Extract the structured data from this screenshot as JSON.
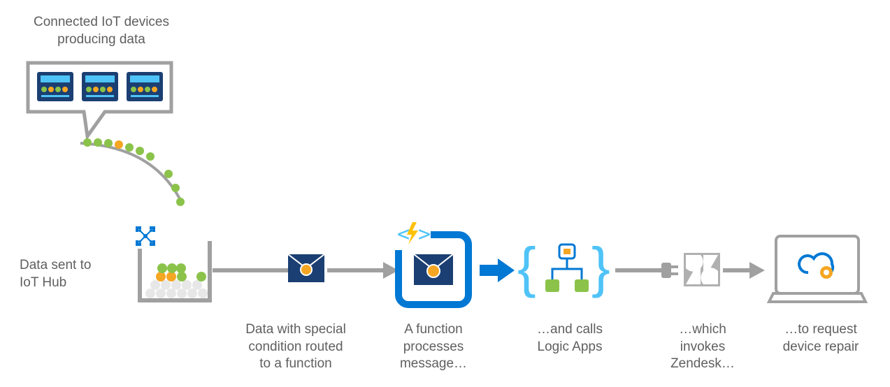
{
  "labels": {
    "devices_title_1": "Connected IoT devices",
    "devices_title_2": "producing data",
    "hub_1": "Data sent to",
    "hub_2": "IoT Hub",
    "routed_1": "Data with special",
    "routed_2": "condition routed",
    "routed_3": "to a function",
    "function_1": "A function",
    "function_2": "processes",
    "function_3": "message…",
    "logic_1": "…and calls",
    "logic_2": "Logic Apps",
    "zendesk_1": "…which",
    "zendesk_2": "invokes",
    "zendesk_3": "Zendesk…",
    "repair_1": "…to request",
    "repair_2": "device repair"
  },
  "colors": {
    "blue": "#0078d4",
    "dark_blue": "#1b3f72",
    "light_blue": "#4fc3f7",
    "gray": "#a0a0a0",
    "green": "#8bc34a",
    "orange": "#f5a623",
    "yellow": "#ffc107"
  }
}
